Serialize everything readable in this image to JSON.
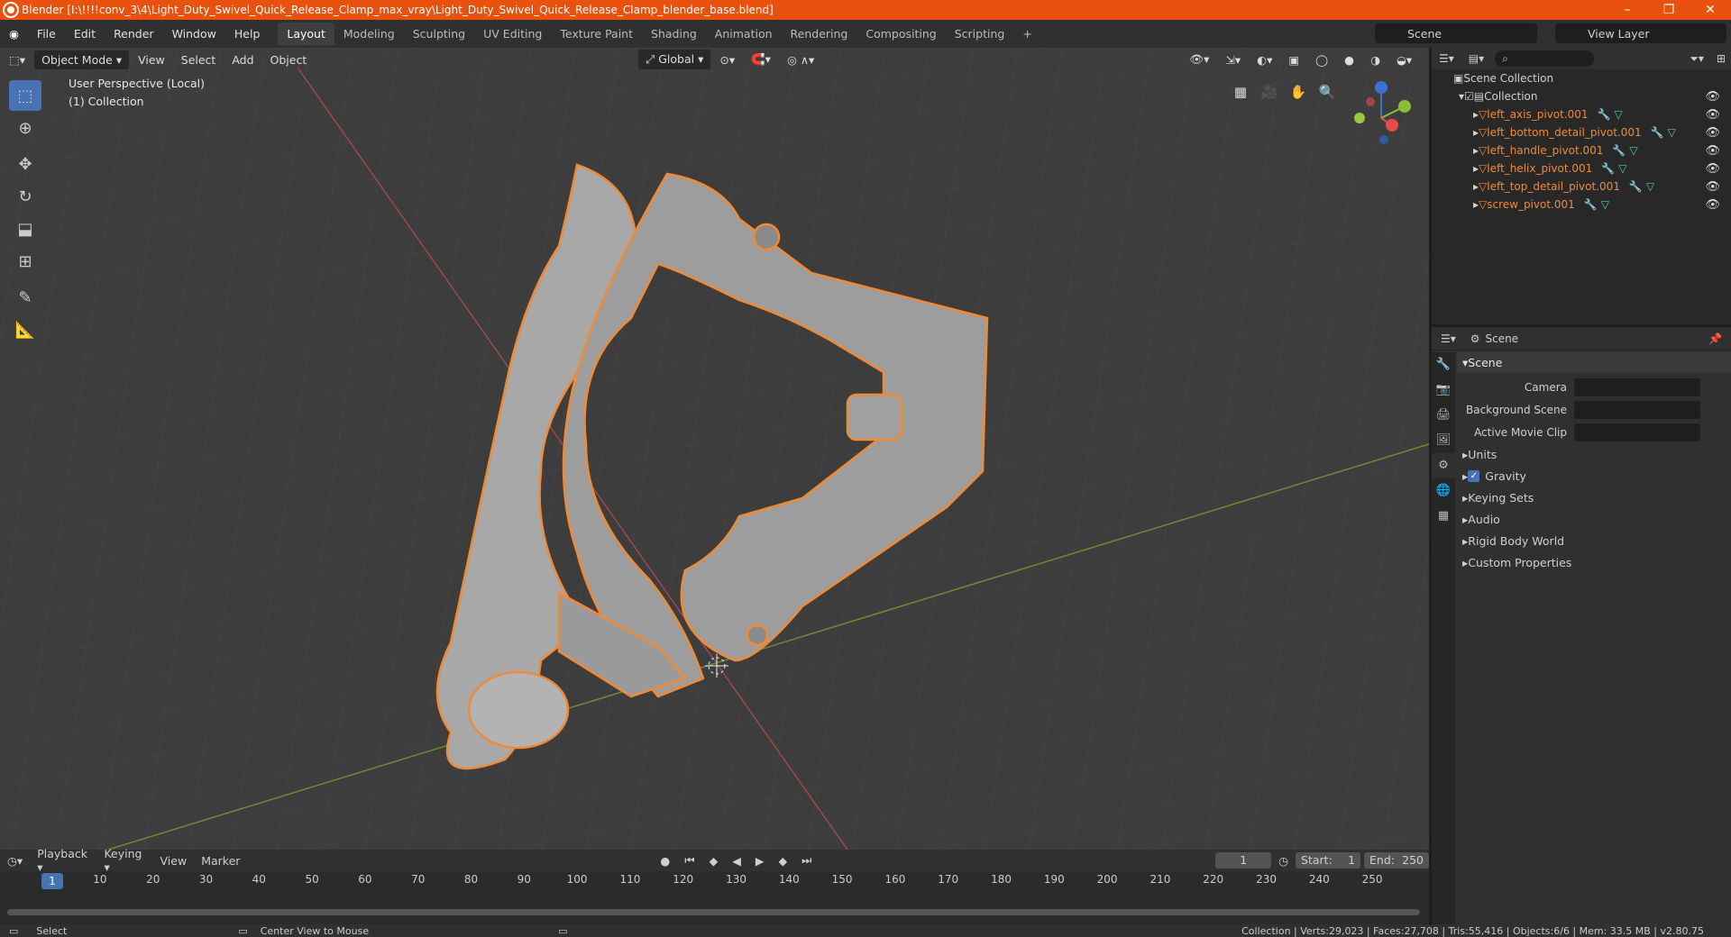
{
  "window": {
    "title": "Blender [I:\\!!!!conv_3\\4\\Light_Duty_Swivel_Quick_Release_Clamp_max_vray\\Light_Duty_Swivel_Quick_Release_Clamp_blender_base.blend]"
  },
  "menu": {
    "items": [
      "File",
      "Edit",
      "Render",
      "Window",
      "Help"
    ]
  },
  "workspaces": [
    "Layout",
    "Modeling",
    "Sculpting",
    "UV Editing",
    "Texture Paint",
    "Shading",
    "Animation",
    "Rendering",
    "Compositing",
    "Scripting"
  ],
  "active_workspace": "Layout",
  "scene_name": "Scene",
  "view_layer": "View Layer",
  "viewport": {
    "mode": "Object Mode",
    "menus": [
      "View",
      "Select",
      "Add",
      "Object"
    ],
    "transform": "Global",
    "perspective": "User Perspective (Local)",
    "collection": "(1) Collection"
  },
  "timeline": {
    "menus": [
      "Playback",
      "Keying",
      "View",
      "Marker"
    ],
    "current_frame": "1",
    "start_label": "Start:",
    "start": "1",
    "end_label": "End:",
    "end": "250",
    "ruler": [
      "1",
      "10",
      "20",
      "30",
      "40",
      "50",
      "60",
      "70",
      "80",
      "90",
      "100",
      "110",
      "120",
      "130",
      "140",
      "150",
      "160",
      "170",
      "180",
      "190",
      "200",
      "210",
      "220",
      "230",
      "240",
      "250"
    ]
  },
  "status": {
    "select": "Select",
    "center": "Center View to Mouse",
    "stats": "Collection | Verts:29,023 | Faces:27,708 | Tris:55,416 | Objects:6/6 | Mem: 33.5 MB | v2.80.75"
  },
  "outliner": {
    "root": "Scene Collection",
    "collection": "Collection",
    "objects": [
      "left_axis_pivot.001",
      "left_bottom_detail_pivot.001",
      "left_handle_pivot.001",
      "left_helix_pivot.001",
      "left_top_detail_pivot.001",
      "screw_pivot.001"
    ]
  },
  "properties": {
    "context": "Scene",
    "panel": "Scene",
    "fields": [
      "Camera",
      "Background Scene",
      "Active Movie Clip"
    ],
    "subpanels": [
      "Units",
      "Gravity",
      "Keying Sets",
      "Audio",
      "Rigid Body World",
      "Custom Properties"
    ]
  },
  "colors": {
    "accent": "#4772b3",
    "selection": "#f08a35",
    "titlebar": "#e8510e"
  }
}
